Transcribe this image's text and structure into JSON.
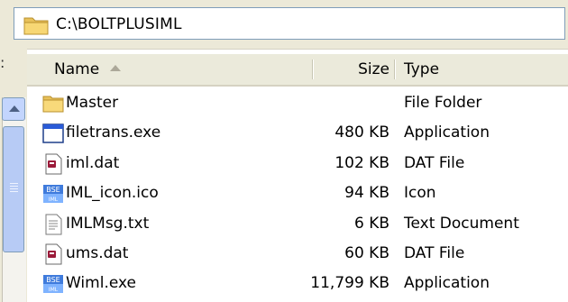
{
  "address": {
    "path": "C:\\BOLTPLUSIML",
    "icon": "folder-icon"
  },
  "left_pane": {
    "glyph": ":"
  },
  "columns": {
    "name": "Name",
    "size": "Size",
    "type": "Type"
  },
  "files": [
    {
      "name": "Master",
      "size": "",
      "type": "File Folder",
      "icon": "folder-icon"
    },
    {
      "name": "filetrans.exe",
      "size": "480 KB",
      "type": "Application",
      "icon": "application-window-icon"
    },
    {
      "name": "iml.dat",
      "size": "102 KB",
      "type": "DAT File",
      "icon": "dat-file-icon"
    },
    {
      "name": "IML_icon.ico",
      "size": "94 KB",
      "type": "Icon",
      "icon": "bse-iml-icon"
    },
    {
      "name": "IMLMsg.txt",
      "size": "6 KB",
      "type": "Text Document",
      "icon": "text-document-icon"
    },
    {
      "name": "ums.dat",
      "size": "60 KB",
      "type": "DAT File",
      "icon": "dat-file-icon"
    },
    {
      "name": "Wiml.exe",
      "size": "11,799 KB",
      "type": "Application",
      "icon": "bse-iml-icon"
    }
  ],
  "colors": {
    "chrome": "#ece9d8",
    "header": "#ebeadb",
    "border": "#7f9db9",
    "scroll_blue": "#b7cbf5"
  }
}
